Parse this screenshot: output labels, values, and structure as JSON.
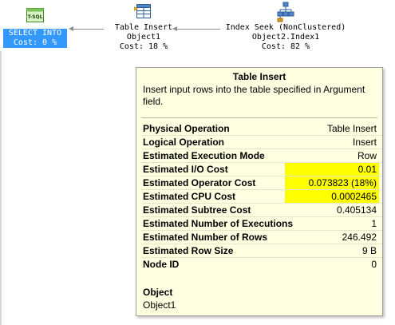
{
  "plan": {
    "nodes": [
      {
        "id": "select",
        "icon_name": "tsql-icon",
        "icon_text": "T-SQL",
        "line1": "SELECT INTO",
        "line2": "Cost: 0 %",
        "selected": true
      },
      {
        "id": "insert",
        "icon_name": "table-insert-icon",
        "line1": "Table Insert",
        "line2": "Object1",
        "line3": "Cost: 18 %"
      },
      {
        "id": "seek",
        "icon_name": "index-seek-icon",
        "line1": "Index Seek (NonClustered)",
        "line2": "Object2.Index1",
        "line3": "Cost: 82 %"
      }
    ]
  },
  "tooltip": {
    "title": "Table Insert",
    "description": "Insert input rows into the table specified in Argument field.",
    "properties": [
      {
        "label": "Physical Operation",
        "value": "Table Insert",
        "highlight": false
      },
      {
        "label": "Logical Operation",
        "value": "Insert",
        "highlight": false
      },
      {
        "label": "Estimated Execution Mode",
        "value": "Row",
        "highlight": false
      },
      {
        "label": "Estimated I/O Cost",
        "value": "0.01",
        "highlight": true
      },
      {
        "label": "Estimated Operator Cost",
        "value": "0.073823 (18%)",
        "highlight": true
      },
      {
        "label": "Estimated CPU Cost",
        "value": "0.0002465",
        "highlight": true
      },
      {
        "label": "Estimated Subtree Cost",
        "value": "0.405134",
        "highlight": false
      },
      {
        "label": "Estimated Number of Executions",
        "value": "1",
        "highlight": false
      },
      {
        "label": "Estimated Number of Rows",
        "value": "246.492",
        "highlight": false
      },
      {
        "label": "Estimated Row Size",
        "value": "9 B",
        "highlight": false
      },
      {
        "label": "Node ID",
        "value": "0",
        "highlight": false
      }
    ],
    "object_label": "Object",
    "object_value": "Object1"
  },
  "colors": {
    "selection": "#3399ff",
    "tooltip_bg": "#ffffe1",
    "highlight": "#ffff00"
  }
}
